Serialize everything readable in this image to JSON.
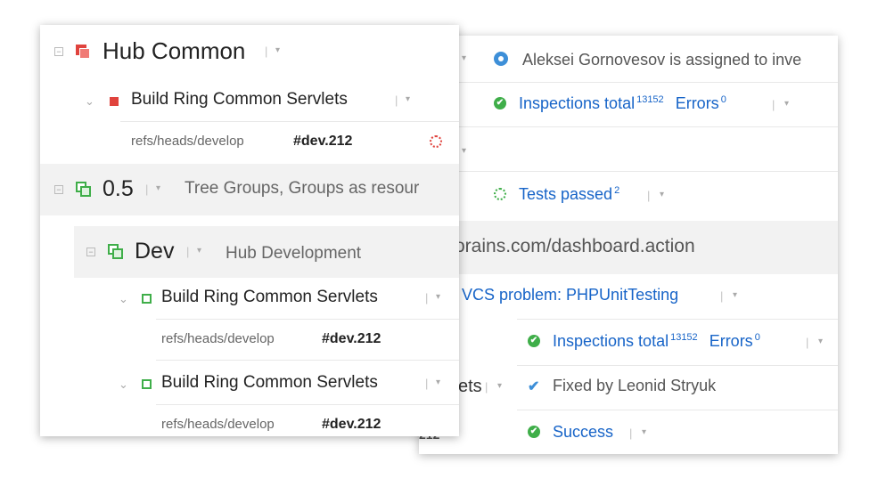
{
  "back": {
    "assignment_text": "Aleksei Gornovesov is assigned to inve",
    "inspections_1": {
      "label": "Inspections total",
      "count": "13152",
      "errors_label": "Errors",
      "errors": "0"
    },
    "tests": {
      "label": "Tests passed",
      "count": "2"
    },
    "url_text": "orains.com/dashboard.action",
    "vcs_problem": "VCS problem: PHPUnitTesting",
    "inspections_2": {
      "label": "Inspections total",
      "count": "13152",
      "errors_label": "Errors",
      "errors": "0"
    },
    "truncated_ets": "ets",
    "fixed_by": "Fixed by Leonid Stryuk",
    "success": "Success",
    "cut_text": "212"
  },
  "front": {
    "hub_common": {
      "title": "Hub Common",
      "build": {
        "name": "Build Ring Common Servlets",
        "branch": "refs/heads/develop",
        "number": "#dev.212"
      }
    },
    "group_05": {
      "title": "0.5",
      "description": "Tree Groups, Groups as resour"
    },
    "dev": {
      "title": "Dev",
      "description": "Hub Development",
      "builds": [
        {
          "name": "Build Ring Common Servlets",
          "branch": "refs/heads/develop",
          "number": "#dev.212"
        },
        {
          "name": "Build Ring Common Servlets",
          "branch": "refs/heads/develop",
          "number": "#dev.212"
        }
      ]
    }
  },
  "colors": {
    "link": "#1764c8",
    "success": "#3fae49",
    "failed": "#e0433d",
    "group_bg": "#f2f2f2"
  },
  "icons": {
    "separator": "|",
    "dropdown": "▾",
    "collapse": "⊟",
    "expand_chevron": "⌄",
    "check": "✔"
  }
}
